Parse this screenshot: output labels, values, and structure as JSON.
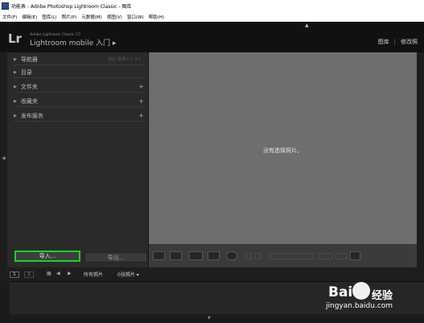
{
  "window": {
    "title": "功能表 - Adobe Photoshop Lightroom Classic - 图库"
  },
  "menu": [
    "文件(F)",
    "编辑(E)",
    "图库(L)",
    "照片(P)",
    "元数据(M)",
    "视图(V)",
    "窗口(W)",
    "帮助(H)"
  ],
  "header": {
    "logo": "Lr",
    "product": "Adobe Lightroom Classic CC",
    "identity": "Lightroom mobile 入门 ▸",
    "modules": [
      "图库",
      "修改照"
    ]
  },
  "left_panel": {
    "navigator": {
      "label": "导航器",
      "extra": "适合  填满  1:1  3:1"
    },
    "items": [
      {
        "label": "目录",
        "plus": ""
      },
      {
        "label": "文件夹",
        "plus": "+"
      },
      {
        "label": "收藏夹",
        "plus": "+"
      },
      {
        "label": "发布服务",
        "plus": "+"
      }
    ],
    "import_label": "导入...",
    "export_label": "导出..."
  },
  "main": {
    "message": "没有选择照片。"
  },
  "filmstrip": {
    "pages": [
      "1",
      "2"
    ],
    "source": "所有照片",
    "count": "0张照片 ▾"
  },
  "watermark": {
    "brand_left": "Bai",
    "brand_right": "经验",
    "url": "jingyan.baidu.com"
  }
}
